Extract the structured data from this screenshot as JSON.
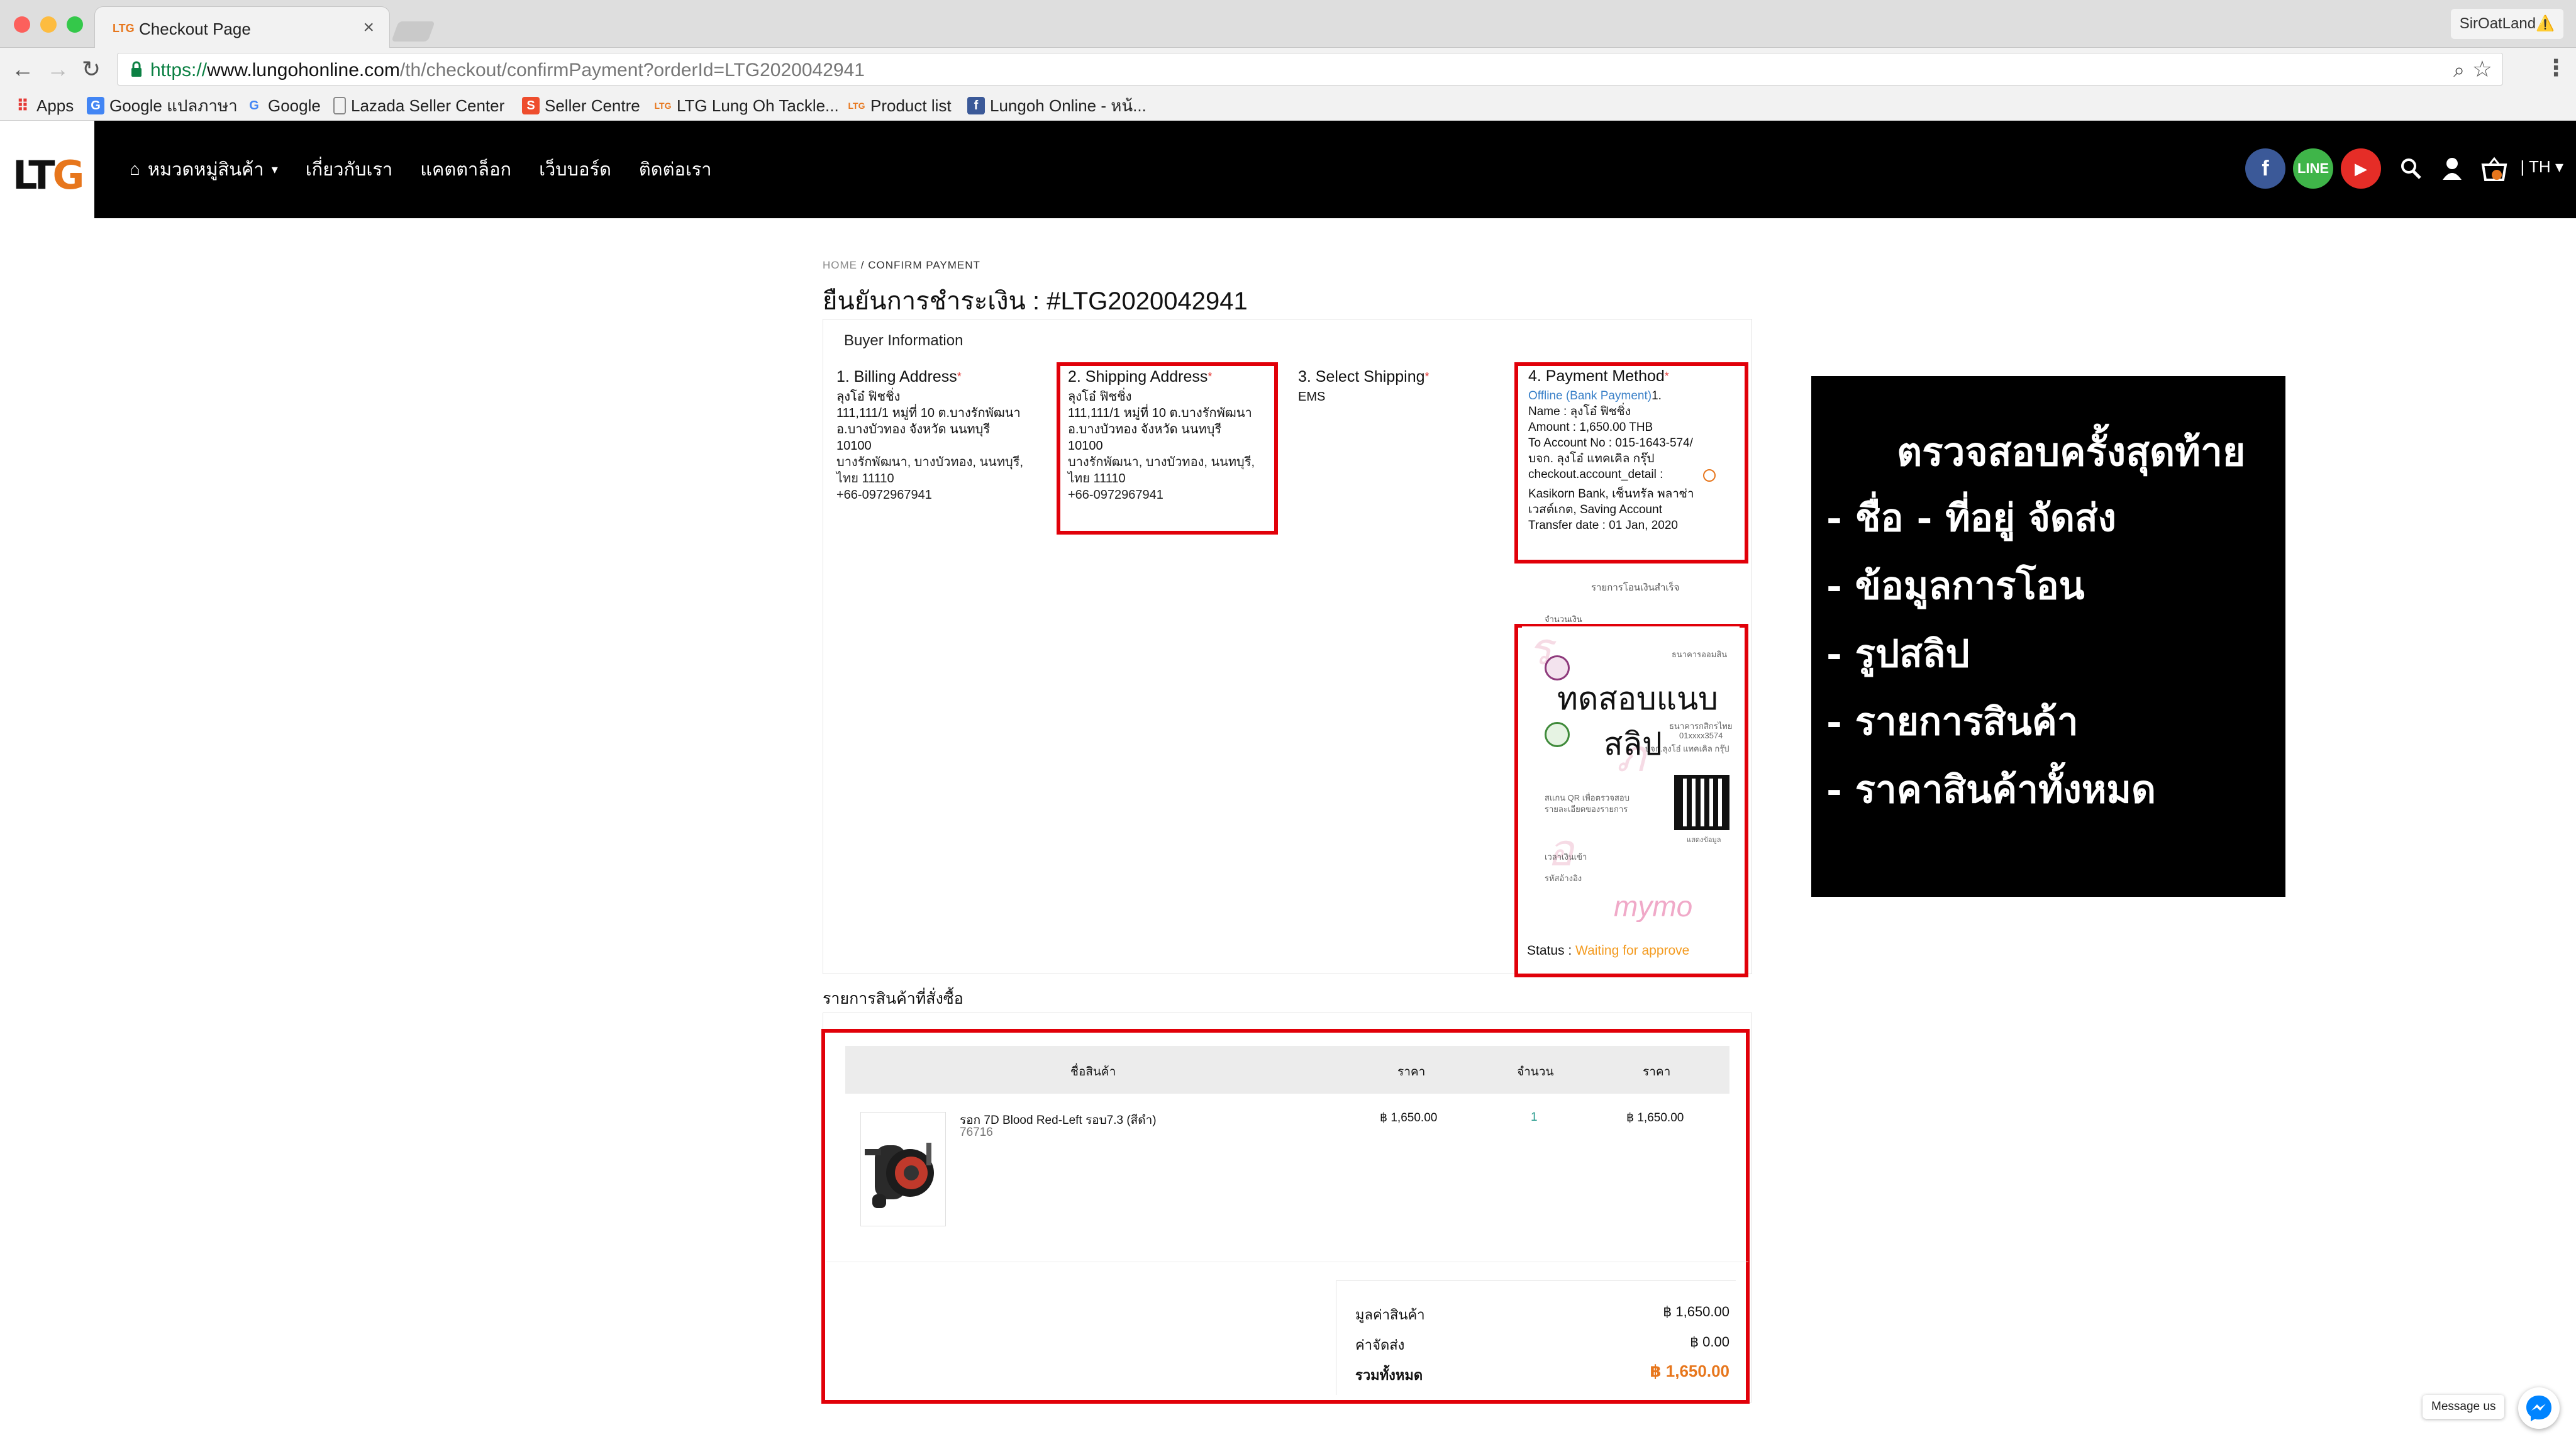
{
  "browser": {
    "tab_title": "Checkout Page",
    "profile": "SirOatLand⚠️",
    "url_secure": "https://",
    "url_host": "www.lungohonline.com",
    "url_path": "/th/checkout/confirmPayment?orderId=LTG2020042941",
    "bookmarks": [
      {
        "label": "Apps",
        "icon": "apps-grid-icon"
      },
      {
        "label": "Google แปลภาษา",
        "icon": "google-translate-icon"
      },
      {
        "label": "Google",
        "icon": "google-icon"
      },
      {
        "label": "Lazada Seller Center",
        "icon": "page-icon"
      },
      {
        "label": "Seller Centre",
        "icon": "shopee-icon"
      },
      {
        "label": "LTG Lung Oh Tackle...",
        "icon": "ltg-icon"
      },
      {
        "label": "Product list",
        "icon": "ltg-icon"
      },
      {
        "label": "Lungoh Online - หน้...",
        "icon": "facebook-icon"
      }
    ]
  },
  "site": {
    "logo_left": "LT",
    "logo_right": "G",
    "nav": [
      {
        "label": "หมวดหมู่สินค้า",
        "dropdown": true
      },
      {
        "label": "เกี่ยวกับเรา"
      },
      {
        "label": "แคตตาล็อก"
      },
      {
        "label": "เว็บบอร์ด"
      },
      {
        "label": "ติดต่อเรา"
      }
    ],
    "lang": "TH",
    "colors": {
      "facebook": "#3b5998",
      "line": "#3fb549",
      "youtube": "#e52d27",
      "accent": "#e7761c",
      "highlight": "#e10009"
    }
  },
  "page": {
    "breadcrumb_home": "HOME",
    "breadcrumb_sep": "/",
    "breadcrumb_current": "CONFIRM PAYMENT",
    "title": "ยืนยันการชำระเงิน : #LTG2020042941"
  },
  "buyer": {
    "heading": "Buyer Information",
    "billing": {
      "title": "1. Billing Address",
      "name": "ลุงโอ๋ ฟิชชิ่ง",
      "line1": "111,111/1 หมู่ที่ 10 ต.บางรักพัฒนา",
      "line2": "อ.บางบัวทอง จังหวัด นนทบุรี",
      "zip": "10100",
      "line3": "บางรักพัฒนา, บางบัวทอง, นนทบุรี,",
      "line4": "ไทย 11110",
      "phone": "+66-0972967941"
    },
    "shipping": {
      "title": "2. Shipping Address",
      "name": "ลุงโอ๋ ฟิชชิ่ง",
      "line1": "111,111/1 หมู่ที่ 10 ต.บางรักพัฒนา",
      "line2": "อ.บางบัวทอง จังหวัด นนทบุรี",
      "zip": "10100",
      "line3": "บางรักพัฒนา, บางบัวทอง, นนทบุรี,",
      "line4": "ไทย 11110",
      "phone": "+66-0972967941"
    },
    "select_shipping": {
      "title": "3. Select Shipping",
      "value": "EMS"
    },
    "payment": {
      "title": "4. Payment Method",
      "method": "Offline (Bank Payment)",
      "method_suffix": "1.",
      "name": "Name : ลุงโอ๋ ฟิชชิ่ง",
      "amount": "Amount : 1,650.00 THB",
      "account_no": "To Account No : 015-1643-574/",
      "account_name": "บจก. ลุงโอ๋ แทคเคิล กรุ๊ป",
      "account_detail": "checkout.account_detail :",
      "bank1": "Kasikorn Bank, เซ็นทรัล พลาซ่า",
      "bank2": "เวสต์เกต, Saving Account",
      "transfer_date": "Transfer date : 01 Jan, 2020"
    },
    "slip": {
      "caption": "รายการโอนเงินสำเร็จ",
      "amount_label": "จำนวนเงิน",
      "bank_top": "ธนาคารออมสิน",
      "bank_mid": "ธนาคารกสิกรไทย",
      "acct": "01xxxx3574",
      "acct_name": "บจก.ลุงโอ๋ แทคเคิล กรุ๊ป",
      "test_line1": "ทดสอบแนบ",
      "test_line2": "สลิป",
      "qr_text1": "สแกน QR เพื่อตรวจสอบ",
      "qr_text2": "รายละเอียดของรายการ",
      "qr_caption": "แสดงข้อมูล",
      "time_label": "เวลาเงินเข้า",
      "ref_label": "รหัสอ้างอิง",
      "brand": "mymo"
    },
    "status_label": "Status :",
    "status_value": "Waiting for approve"
  },
  "orders": {
    "label": "รายการสินค้าที่สั่งซื้อ",
    "columns": [
      "ชื่อสินค้า",
      "ราคา",
      "จำนวน",
      "ราคา"
    ],
    "items": [
      {
        "name": "รอก 7D Blood Red-Left รอบ7.3 (สีดำ)",
        "sku": "76716",
        "price": "฿ 1,650.00",
        "qty": "1",
        "total": "฿ 1,650.00"
      }
    ],
    "summary": {
      "subtotal_label": "มูลค่าสินค้า",
      "subtotal": "฿ 1,650.00",
      "shipping_label": "ค่าจัดส่ง",
      "shipping": "฿ 0.00",
      "total_label": "รวมทั้งหมด",
      "total": "฿ 1,650.00"
    }
  },
  "annotation": {
    "title": "ตรวจสอบครั้งสุดท้าย",
    "items": [
      "- ชื่อ - ที่อยู่ จัดส่ง",
      "- ข้อมูลการโอน",
      "- รูปสลิป",
      "- รายการสินค้า",
      "- ราคาสินค้าทั้งหมด"
    ]
  },
  "messenger": {
    "label": "Message us"
  }
}
